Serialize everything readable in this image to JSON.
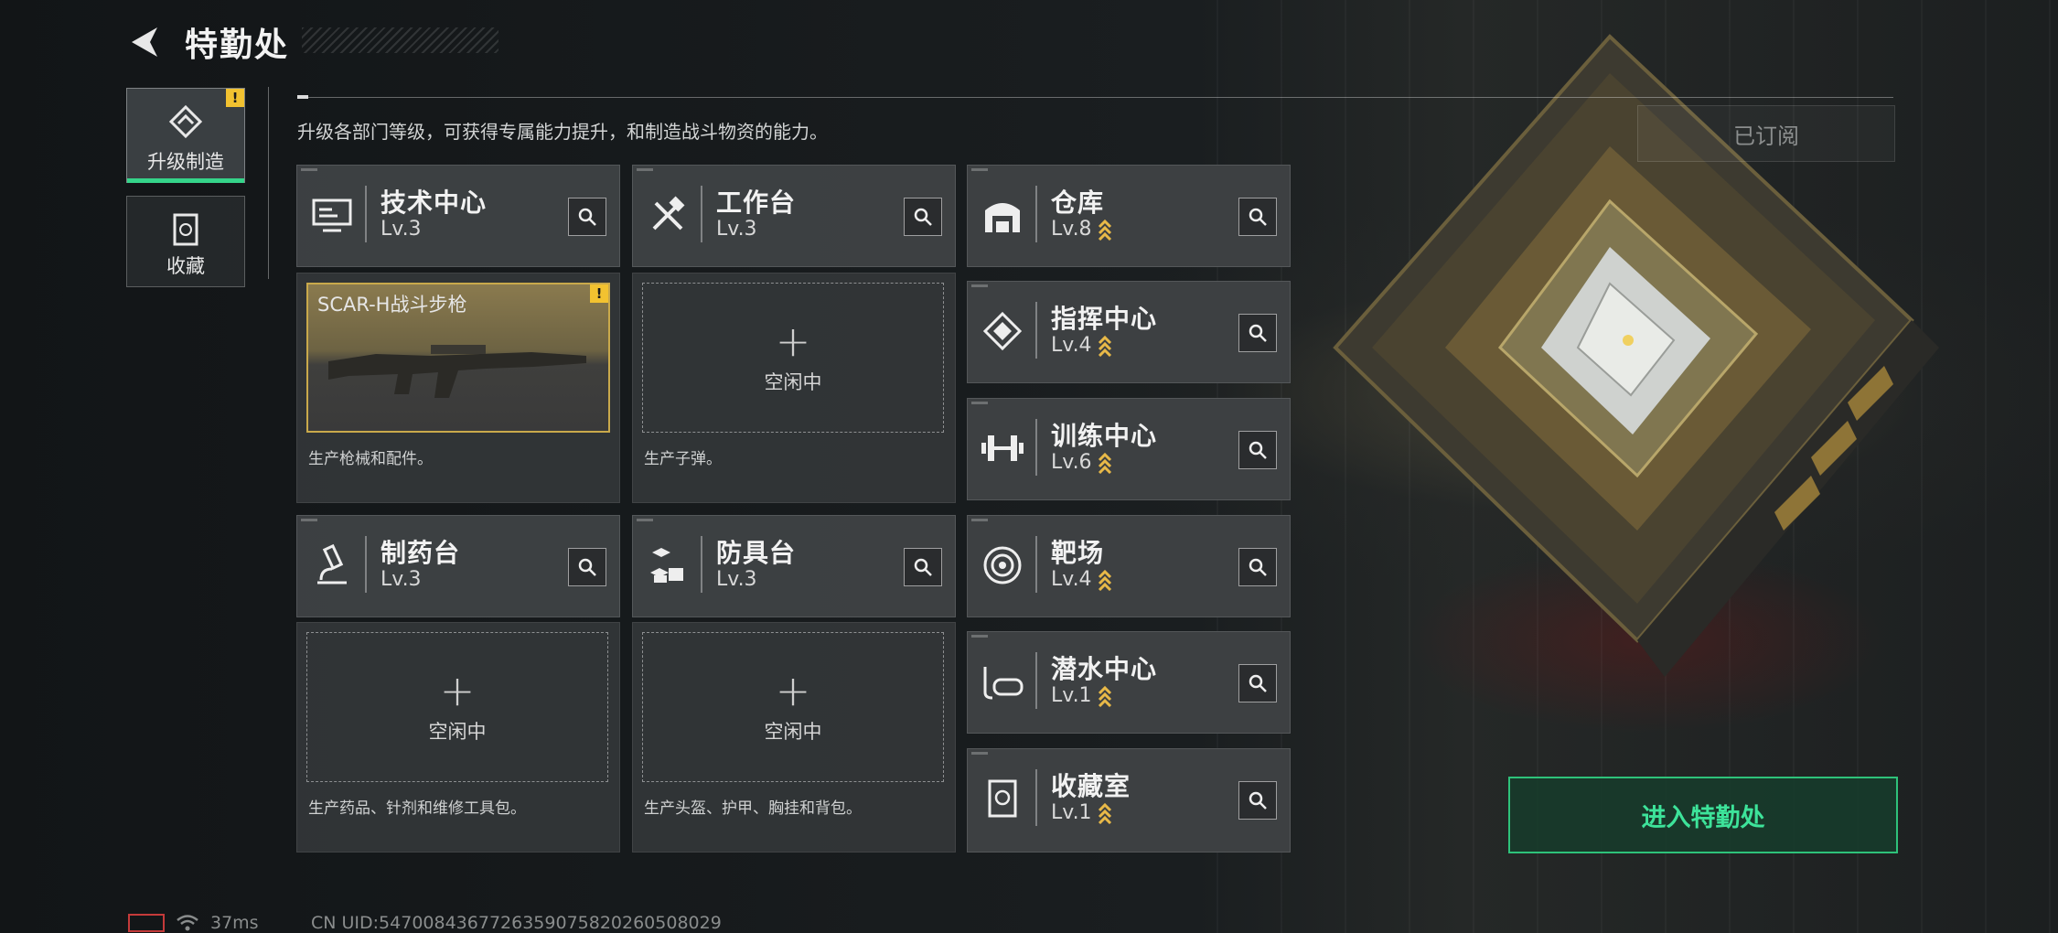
{
  "header": {
    "title": "特勤处",
    "description": "升级各部门等级，可获得专属能力提升，和制造战斗物资的能力。",
    "subscribed_label": "已订阅"
  },
  "tabs": [
    {
      "label": "升级制造",
      "active": true,
      "badge": "!"
    },
    {
      "label": "收藏",
      "active": false
    }
  ],
  "departments": {
    "tech": {
      "name": "技术中心",
      "level": "Lv.3",
      "icon": "monitor-icon"
    },
    "workbench": {
      "name": "工作台",
      "level": "Lv.3",
      "icon": "tools-icon"
    },
    "pharmacy": {
      "name": "制药台",
      "level": "Lv.3",
      "icon": "microscope-icon"
    },
    "armor": {
      "name": "防具台",
      "level": "Lv.3",
      "icon": "cubes-icon"
    },
    "warehouse": {
      "name": "仓库",
      "level": "Lv.8",
      "icon": "warehouse-icon"
    },
    "command": {
      "name": "指挥中心",
      "level": "Lv.4",
      "icon": "chip-icon"
    },
    "training": {
      "name": "训练中心",
      "level": "Lv.6",
      "icon": "dumbbell-icon"
    },
    "range": {
      "name": "靶场",
      "level": "Lv.4",
      "icon": "target-icon"
    },
    "diving": {
      "name": "潜水中心",
      "level": "Lv.1",
      "icon": "diving-mask-icon"
    },
    "collection": {
      "name": "收藏室",
      "level": "Lv.1",
      "icon": "collection-icon"
    }
  },
  "production": {
    "tech": {
      "item": "SCAR-H战斗步枪",
      "badge": "!",
      "desc": "生产枪械和配件。"
    },
    "workbench": {
      "status": "空闲中",
      "desc": "生产子弹。"
    },
    "pharmacy": {
      "status": "空闲中",
      "desc": "生产药品、针剂和维修工具包。"
    },
    "armor": {
      "status": "空闲中",
      "desc": "生产头盔、护甲、胸挂和背包。"
    }
  },
  "enter_button": "进入特勤处",
  "status_bar": {
    "ping": "37ms",
    "uid": "CN UID:5470084367726359075820260508029"
  },
  "colors": {
    "accent_green": "#35d48a",
    "badge_yellow": "#f2c230",
    "weapon_gold": "#c9a94b"
  }
}
